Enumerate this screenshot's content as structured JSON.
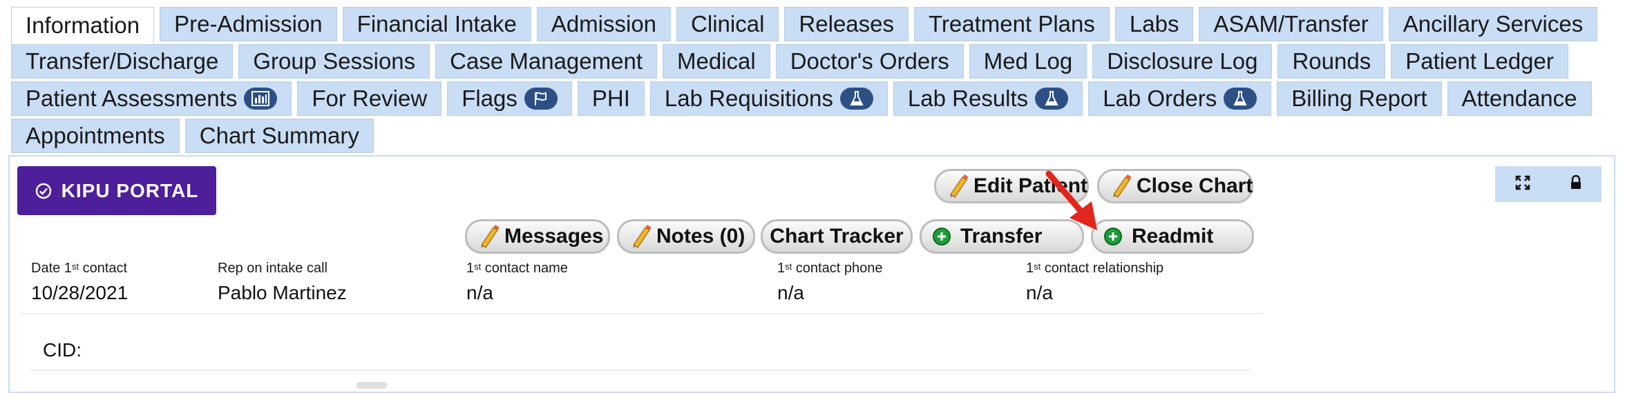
{
  "tabs": {
    "rows": [
      [
        {
          "label": "Information",
          "active": true
        },
        {
          "label": "Pre-Admission"
        },
        {
          "label": "Financial Intake"
        },
        {
          "label": "Admission"
        },
        {
          "label": "Clinical"
        },
        {
          "label": "Releases"
        },
        {
          "label": "Treatment Plans"
        },
        {
          "label": "Labs"
        },
        {
          "label": "ASAM/Transfer"
        },
        {
          "label": "Ancillary Services"
        }
      ],
      [
        {
          "label": "Transfer/Discharge"
        },
        {
          "label": "Group Sessions"
        },
        {
          "label": "Case Management"
        },
        {
          "label": "Medical"
        },
        {
          "label": "Doctor's Orders"
        },
        {
          "label": "Med Log"
        },
        {
          "label": "Disclosure Log"
        },
        {
          "label": "Rounds"
        },
        {
          "label": "Patient Ledger"
        }
      ],
      [
        {
          "label": "Patient Assessments",
          "icon": "bar-chart-icon"
        },
        {
          "label": "For Review"
        },
        {
          "label": "Flags",
          "icon": "flag-icon"
        },
        {
          "label": "PHI"
        },
        {
          "label": "Lab Requisitions",
          "icon": "flask-icon"
        },
        {
          "label": "Lab Results",
          "icon": "flask-icon"
        },
        {
          "label": "Lab Orders",
          "icon": "flask-icon"
        },
        {
          "label": "Billing Report"
        },
        {
          "label": "Attendance"
        }
      ],
      [
        {
          "label": "Appointments"
        },
        {
          "label": "Chart Summary"
        }
      ]
    ]
  },
  "portal_button": {
    "label": "KIPU PORTAL",
    "icon": "check-circle-icon"
  },
  "actions": {
    "edit_patient": "Edit Patient",
    "close_chart": "Close Chart",
    "messages": "Messages",
    "notes": "Notes (0)",
    "chart_tracker": "Chart Tracker",
    "transfer": "Transfer",
    "readmit": "Readmit"
  },
  "tools": {
    "expand_icon": "expand-icon",
    "lock_icon": "lock-icon"
  },
  "fields": {
    "date_first_contact": {
      "label_pre": "Date 1",
      "label_sup": "st",
      "label_post": " contact",
      "value": "10/28/2021"
    },
    "rep_on_intake": {
      "label": "Rep on intake call",
      "value": "Pablo Martinez"
    },
    "first_contact_name": {
      "label_sup": "1",
      "label_sup2": "st",
      "label_post": " contact name",
      "value": "n/a"
    },
    "first_contact_phone": {
      "label_sup": "1",
      "label_sup2": "st",
      "label_post": " contact phone",
      "value": "n/a"
    },
    "first_contact_relationship": {
      "label_sup": "1",
      "label_sup2": "st",
      "label_post": " contact relationship",
      "value": "n/a"
    }
  },
  "cid": {
    "label": "CID:"
  },
  "colors": {
    "tab_bg": "#c9ddf5",
    "portal_bg": "#4d1f9b",
    "badge_bg": "#2c4f86",
    "plus_green": "#1f9d3a",
    "arrow_red": "#e3261d"
  }
}
